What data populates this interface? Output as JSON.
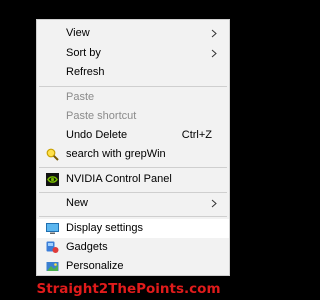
{
  "menu": {
    "view": {
      "label": "View",
      "icon": "submenu-arrow-icon"
    },
    "sort_by": {
      "label": "Sort by",
      "icon": "submenu-arrow-icon"
    },
    "refresh": {
      "label": "Refresh"
    },
    "paste": {
      "label": "Paste",
      "disabled": true
    },
    "paste_shortcut": {
      "label": "Paste shortcut",
      "disabled": true
    },
    "undo_delete": {
      "label": "Undo Delete",
      "shortcut": "Ctrl+Z"
    },
    "search_grepwin": {
      "label": "search with grepWin",
      "icon": "magnifier-icon"
    },
    "nvidia": {
      "label": "NVIDIA Control Panel",
      "icon": "nvidia-logo-icon"
    },
    "new": {
      "label": "New",
      "icon": "submenu-arrow-icon"
    },
    "display_settings": {
      "label": "Display settings",
      "icon": "display-icon",
      "highlighted": true
    },
    "gadgets": {
      "label": "Gadgets",
      "icon": "gadgets-icon"
    },
    "personalize": {
      "label": "Personalize",
      "icon": "personalize-icon"
    }
  },
  "watermark": "Straight2ThePoints.com",
  "colors": {
    "menu_bg": "#f2f2f2",
    "highlight_bg": "#ffffff",
    "disabled_text": "#8b8b8b",
    "separator": "#cfcfcf",
    "watermark": "#e01b1b",
    "desktop_bg": "#000000"
  }
}
